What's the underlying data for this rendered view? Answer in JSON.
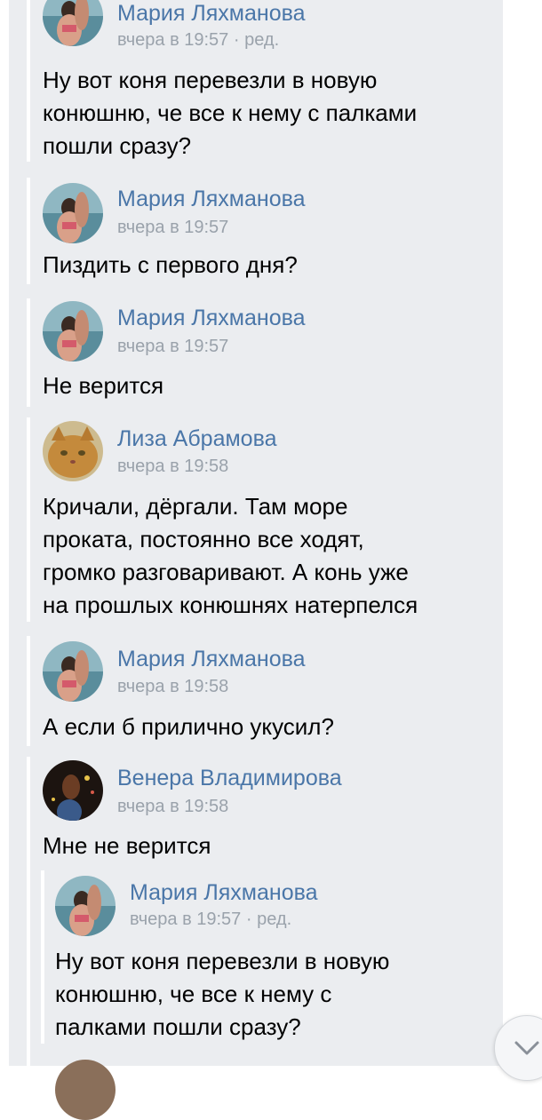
{
  "messages": [
    {
      "author": "Мария Ляхманова",
      "time": "вчера в 19:57",
      "edited": " · ред.",
      "lines": [
        "Ну вот коня перевезли в новую",
        "конюшню, че все к нему с палками",
        "пошли сразу?"
      ]
    },
    {
      "author": "Мария Ляхманова",
      "time": "вчера в 19:57",
      "lines": [
        "Пиздить с первого дня?"
      ]
    },
    {
      "author": "Мария Ляхманова",
      "time": "вчера в 19:57",
      "lines": [
        "Не верится"
      ]
    },
    {
      "author": "Лиза Абрамова",
      "time": "вчера в 19:58",
      "lines": [
        "Кричали, дёргали. Там море",
        "проката, постоянно все ходят,",
        "громко разговаривают. А конь уже",
        "на прошлых конюшнях натерпелся"
      ]
    },
    {
      "author": "Мария Ляхманова",
      "time": "вчера в 19:58",
      "lines": [
        "А если б прилично укусил?"
      ]
    },
    {
      "author": "Венера Владимирова",
      "time": "вчера в 19:58",
      "lines": [
        "Мне не верится"
      ]
    },
    {
      "author": "Мария Ляхманова",
      "time": "вчера в 19:57",
      "edited": " · ред.",
      "lines": [
        "Ну вот коня перевезли в новую",
        "конюшню, че все к нему с",
        "палками пошли сразу?"
      ]
    }
  ],
  "icons": {
    "scroll_down": "chevron-down-icon"
  },
  "colors": {
    "name": "#4a76a8",
    "time": "#9aa2ab",
    "panel": "#ebedf0"
  }
}
